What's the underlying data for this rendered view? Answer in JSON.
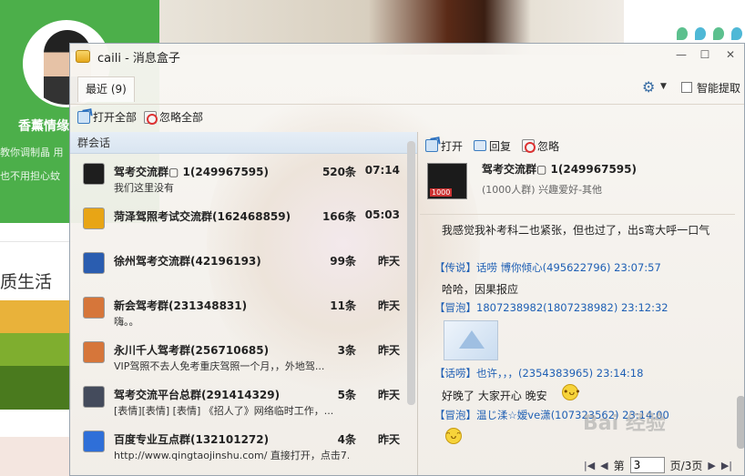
{
  "background_page": {
    "name": "香薰情缘",
    "quote": "教你调制晶 用也不用担心蚊",
    "heading": "质生活"
  },
  "window": {
    "title": "caili - 消息盒子",
    "controls": [
      "minimize",
      "maximize",
      "close"
    ]
  },
  "tabs": {
    "recent": "最近 (9)"
  },
  "settings": {
    "smart_extract": "智能提取",
    "smart_extract_checked": false
  },
  "toolbar": {
    "open_all": "打开全部",
    "ignore_all": "忽略全部"
  },
  "group_list": {
    "header": "群会话",
    "items": [
      {
        "name": "驾考交流群▢  1(249967595)",
        "count": "520条",
        "time": "07:14",
        "preview": "我们这里没有",
        "icon_color": "#1e1e1e"
      },
      {
        "name": "菏泽驾照考试交流群(162468859)",
        "count": "166条",
        "time": "05:03",
        "preview": "",
        "icon_color": "#e8a515"
      },
      {
        "name": "徐州驾考交流群(42196193)",
        "count": "99条",
        "time": "昨天",
        "preview": "",
        "icon_color": "#2a5db0"
      },
      {
        "name": "新会驾考群(231348831)",
        "count": "11条",
        "time": "昨天",
        "preview": "嗨。。",
        "icon_color": "#d6763a"
      },
      {
        "name": "永川千人驾考群(256710685)",
        "count": "3条",
        "time": "昨天",
        "preview": "VIP驾照不去人免考重庆驾照一个月，，外地驾...",
        "icon_color": "#d6763a"
      },
      {
        "name": "驾考交流平台总群(291414329)",
        "count": "5条",
        "time": "昨天",
        "preview": "[表情][表情] [表情]  《招人了》网络临时工作，...",
        "icon_color": "#444b5c"
      },
      {
        "name": "百度专业互点群(132101272)",
        "count": "4条",
        "time": "昨天",
        "preview": "http://www.qingtaojinshu.com/ 直接打开，点击7...",
        "icon_color": "#2f6fd8"
      }
    ]
  },
  "right_toolbar": {
    "open": "打开",
    "reply": "回复",
    "ignore": "忽略"
  },
  "group_detail": {
    "avatar_badge": "1000",
    "name": "驾考交流群▢  1(249967595)",
    "meta": "(1000人群) 兴趣爱好-其他"
  },
  "chat": {
    "messages": [
      {
        "type": "text",
        "text": "我感觉我补考科二也紧张，但也过了，出s弯大呼一口气"
      },
      {
        "type": "meta",
        "text": "【传说】话唠  博你倾心(495622796) 23:07:57"
      },
      {
        "type": "text",
        "text": "哈哈，因果报应"
      },
      {
        "type": "meta",
        "text": "【冒泡】1807238982(1807238982) 23:12:32"
      },
      {
        "type": "meta",
        "text": "【话唠】也许，，，(2354383965) 23:14:18"
      },
      {
        "type": "text",
        "text": "好晚了 大家开心  晚安"
      },
      {
        "type": "meta",
        "text": "【冒泡】温じ渘☆嫒ve潇(107323562) 23:14:00"
      }
    ]
  },
  "pager": {
    "label_before": "第",
    "page": "3",
    "label_after": "页/3页"
  },
  "watermark": "Bai 经验"
}
